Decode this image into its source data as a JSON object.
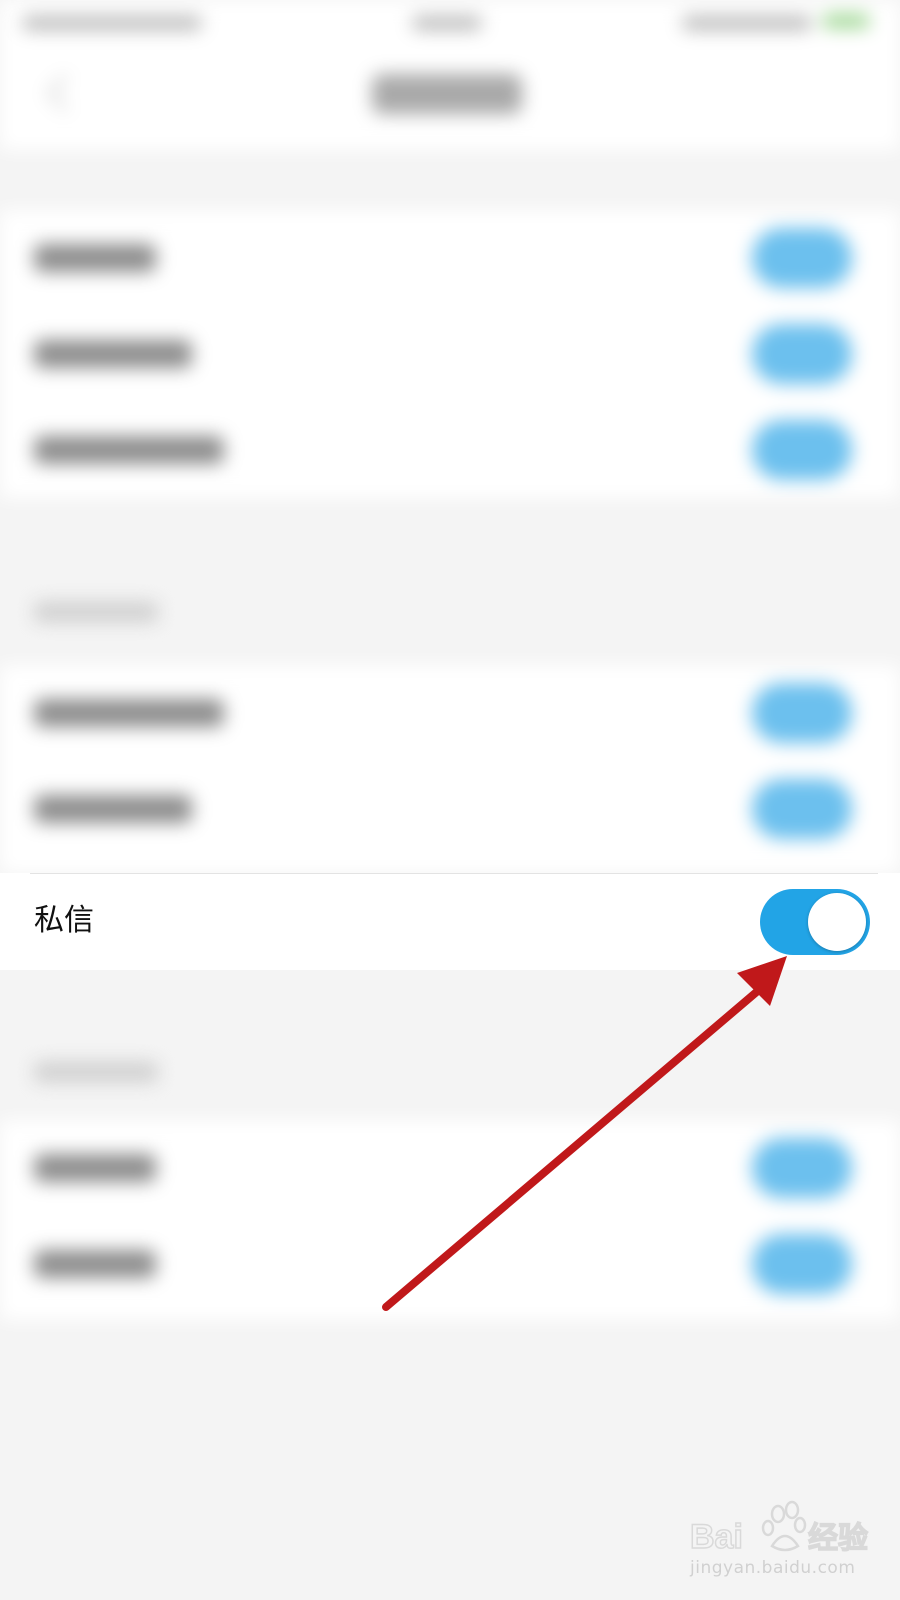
{
  "settings": {
    "private_message": {
      "label": "私信",
      "toggle_state": "on"
    }
  },
  "colors": {
    "toggle_on": "#22a4e6",
    "arrow": "#c0181a",
    "page_background": "#f4f4f4"
  },
  "annotation": {
    "type": "red-arrow",
    "points_to": "private-message-toggle"
  },
  "watermark": {
    "brand": "Baidu经验",
    "url": "jingyan.baidu.com"
  }
}
